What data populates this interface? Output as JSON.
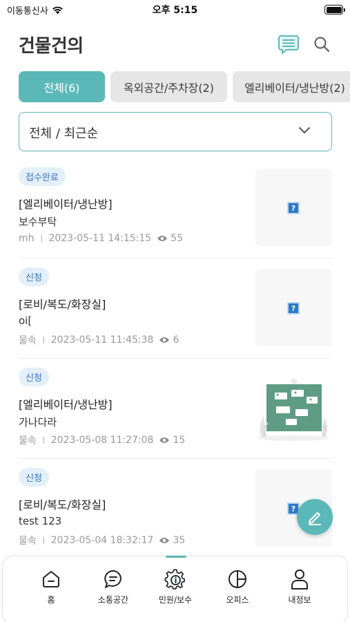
{
  "status_bar": {
    "carrier": "이동통신사",
    "time": "오후 5:15"
  },
  "header": {
    "title": "건물건의",
    "icons": [
      "chat-icon",
      "search-icon"
    ]
  },
  "tabs": [
    {
      "label": "전체(6)",
      "active": true
    },
    {
      "label": "옥외공간/주차장(2)",
      "active": false
    },
    {
      "label": "엘리베이터/냉난방(2)",
      "active": false
    }
  ],
  "filter": {
    "selected": "전체 / 최근순"
  },
  "posts": [
    {
      "status": "접수완료",
      "category": "[엘리베이터/냉난방]",
      "body": "보수부탁",
      "author": "mh",
      "datetime": "2023-05-11 14:15:15",
      "views": "55",
      "thumbnail": "broken-image"
    },
    {
      "status": "신청",
      "category": "[로비/복도/화장실]",
      "body": "oi[",
      "author": "물속",
      "datetime": "2023-05-11 11:45:38",
      "views": "6",
      "thumbnail": "broken-image"
    },
    {
      "status": "신청",
      "category": "[엘리베이터/냉난방]",
      "body": "가나다라",
      "author": "물속",
      "datetime": "2023-05-08 11:27:08",
      "views": "15",
      "thumbnail": "board-illustration"
    },
    {
      "status": "신청",
      "category": "[로비/복도/화장실]",
      "body": "test 123",
      "author": "물속",
      "datetime": "2023-05-04 18:32:17",
      "views": "35",
      "thumbnail": "broken-image"
    }
  ],
  "fab": {
    "icon": "pencil-icon"
  },
  "bottom_nav": [
    {
      "label": "홈",
      "icon": "home-icon"
    },
    {
      "label": "소통공간",
      "icon": "chat-bubble-icon"
    },
    {
      "label": "민원/보수",
      "icon": "gear-info-icon",
      "active": true
    },
    {
      "label": "오피스",
      "icon": "pie-chart-icon"
    },
    {
      "label": "내정보",
      "icon": "person-icon"
    }
  ],
  "colors": {
    "accent": "#5bb8b8",
    "badge_bg": "#e3f0fa",
    "badge_text": "#3e74b8",
    "tab_inactive": "#e6e6e6"
  }
}
